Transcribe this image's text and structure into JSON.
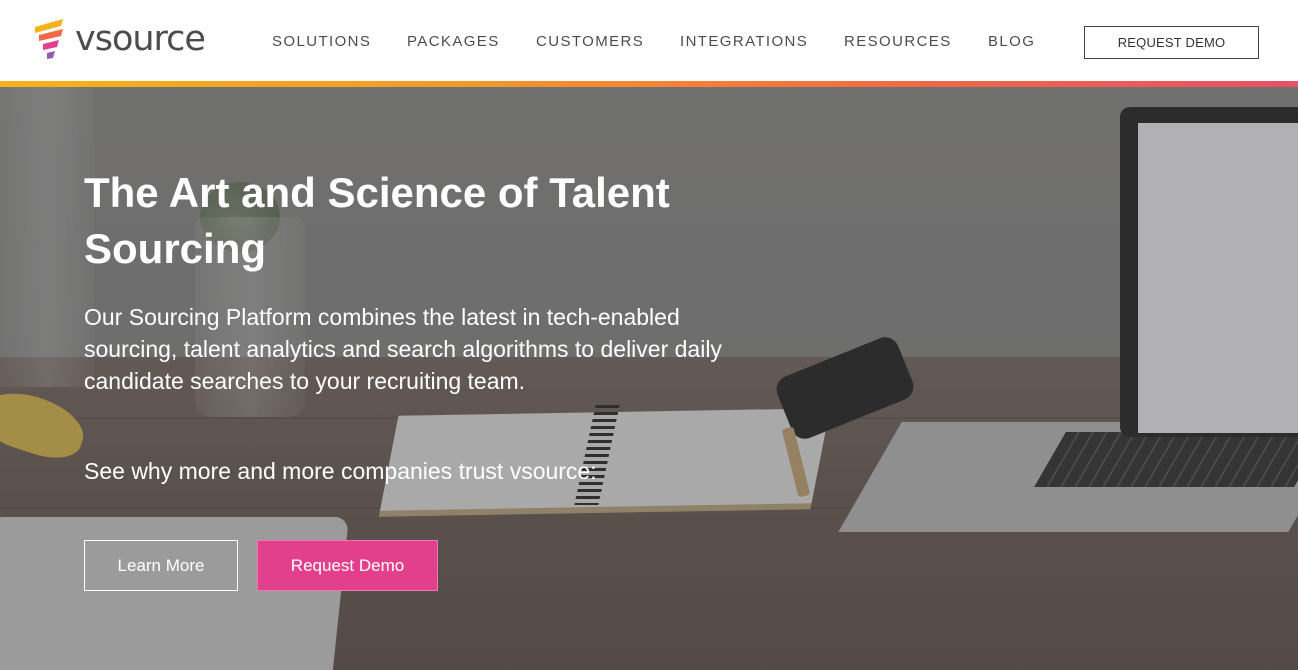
{
  "brand": {
    "name": "vsource",
    "colors": {
      "yellow": "#f5b21b",
      "orange": "#ef6a45",
      "pink": "#e2408c",
      "purple": "#8e5fb0"
    }
  },
  "nav": {
    "items": [
      {
        "label": "SOLUTIONS"
      },
      {
        "label": "PACKAGES"
      },
      {
        "label": "CUSTOMERS"
      },
      {
        "label": "INTEGRATIONS"
      },
      {
        "label": "RESOURCES"
      },
      {
        "label": "BLOG"
      }
    ],
    "cta_label": "REQUEST DEMO"
  },
  "hero": {
    "title": "The Art and Science of Talent Sourcing",
    "body": "Our Sourcing Platform combines the latest in tech-enabled sourcing, talent analytics and search algorithms to deliver daily candidate searches to your recruiting team.",
    "trust": "See why more and more companies trust vsource:",
    "learn_more_label": "Learn More",
    "request_demo_label": "Request Demo"
  }
}
